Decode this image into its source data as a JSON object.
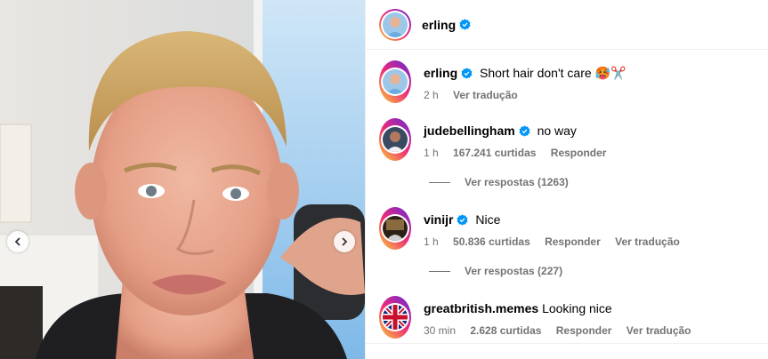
{
  "post": {
    "author": "erling",
    "caption": "Short hair don't care 🥵✂️",
    "time": "2 h",
    "see_translation": "Ver tradução"
  },
  "comments": [
    {
      "user": "judebellingham",
      "verified": true,
      "text": "no way",
      "time": "1 h",
      "likes": "167.241 curtidas",
      "reply": "Responder",
      "translate": "",
      "view_replies": "Ver respostas (1263)"
    },
    {
      "user": "vinijr",
      "verified": true,
      "text": "Nice",
      "time": "1 h",
      "likes": "50.836 curtidas",
      "reply": "Responder",
      "translate": "Ver tradução",
      "view_replies": "Ver respostas (227)"
    },
    {
      "user": "greatbritish.memes",
      "verified": false,
      "text": "Looking nice",
      "time": "30 min",
      "likes": "2.628 curtidas",
      "reply": "Responder",
      "translate": "Ver tradução",
      "view_replies": ""
    }
  ],
  "colors": {
    "verified_blue": "#0095f6",
    "meta_gray": "#737373"
  },
  "icons": {
    "verified": "verified-badge-icon",
    "prev": "chevron-left-icon",
    "next": "chevron-right-icon"
  }
}
